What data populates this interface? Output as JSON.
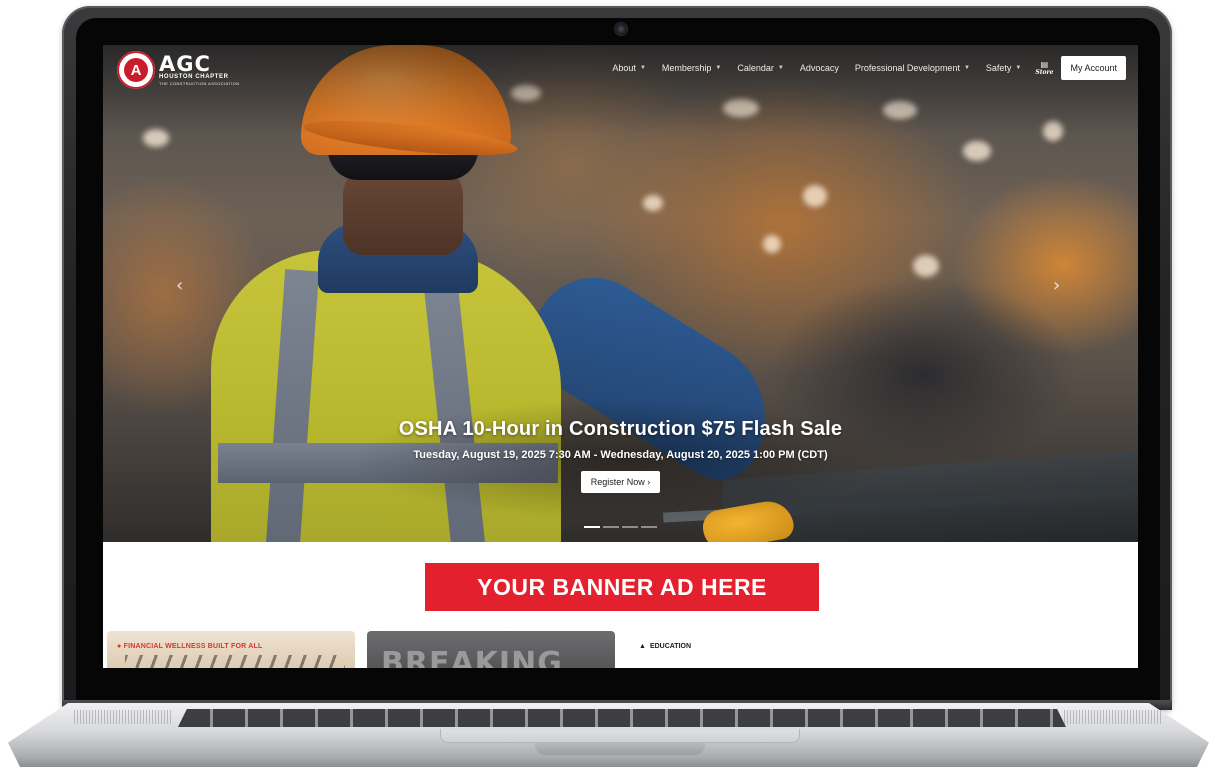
{
  "brand": {
    "seal_letter": "A",
    "name": "AGC",
    "chapter": "HOUSTON CHAPTER",
    "tagline": "THE CONSTRUCTION ASSOCIATION"
  },
  "nav": {
    "items": [
      {
        "label": "About",
        "has_dropdown": true
      },
      {
        "label": "Membership",
        "has_dropdown": true
      },
      {
        "label": "Calendar",
        "has_dropdown": true
      },
      {
        "label": "Advocacy",
        "has_dropdown": false
      },
      {
        "label": "Professional Development",
        "has_dropdown": true
      },
      {
        "label": "Safety",
        "has_dropdown": true
      }
    ],
    "store_label": "Store",
    "account_label": "My Account"
  },
  "hero": {
    "title": "OSHA 10-Hour in Construction $75 Flash Sale",
    "date": "Tuesday, August 19, 2025 7:30 AM - Wednesday, August 20, 2025 1:00 PM (CDT)",
    "cta_label": "Register Now",
    "cta_arrow": "›",
    "prev_arrow": "‹",
    "next_arrow": "›",
    "slide_count": 4,
    "active_slide": 1
  },
  "banner": {
    "text": "YOUR BANNER AD HERE",
    "color": "#e3202d"
  },
  "cards": {
    "card1_title": "FINANCIAL WELLNESS BUILT FOR ALL",
    "card2_title": "BREAKING",
    "card3_tag": "EDUCATION"
  },
  "icons": {
    "dropdown": "chevron-down-icon",
    "store": "store-icon",
    "education": "graduation-cap-icon"
  }
}
